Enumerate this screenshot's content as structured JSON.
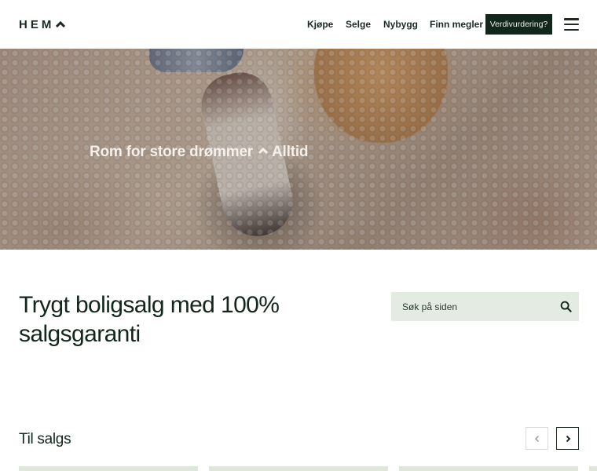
{
  "header": {
    "logo_text": "HEM",
    "nav": [
      {
        "label": "Kjøpe"
      },
      {
        "label": "Selge"
      },
      {
        "label": "Nybygg"
      },
      {
        "label": "Finn megler"
      }
    ],
    "cta_label": "Verdivurdering?",
    "menu_icon": "hamburger-icon"
  },
  "hero": {
    "tagline_left": "Rom for store drømmer",
    "tagline_right": "Alltid"
  },
  "intro": {
    "headline": "Trygt boligsalg med 100% salgsgaranti",
    "search_placeholder": "Søk på siden",
    "search_icon": "search-icon"
  },
  "listings": {
    "title": "Til salgs",
    "prev_icon": "chevron-left-icon",
    "next_icon": "chevron-right-icon"
  },
  "colors": {
    "brand_dark": "#13261b",
    "search_bg": "#e3ebe2",
    "cta_text": "#e9f0e6"
  }
}
